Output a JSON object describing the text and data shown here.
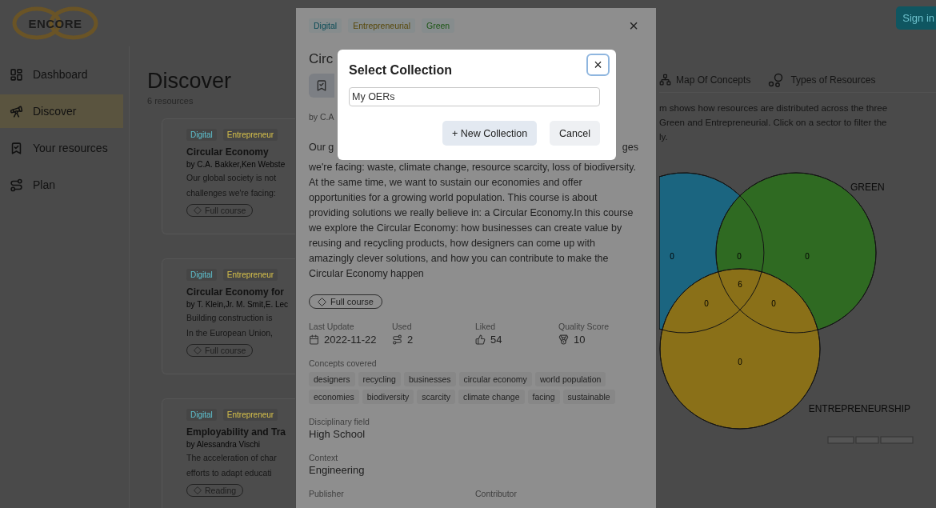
{
  "header": {
    "logo": "ENCORE",
    "sign_in": "Sign in"
  },
  "sidebar": {
    "items": [
      {
        "label": "Dashboard",
        "selected": false
      },
      {
        "label": "Discover",
        "selected": true
      },
      {
        "label": "Your resources",
        "selected": false
      },
      {
        "label": "Plan",
        "selected": false
      }
    ]
  },
  "discover": {
    "title": "Discover",
    "count": "6 resources",
    "cards": [
      {
        "tags": [
          {
            "label": "Digital",
            "color": "#5ec3d1"
          },
          {
            "label": "Entrepreneur",
            "color": "#d6c04a"
          }
        ],
        "title": "Circular Economy",
        "authors": "by C.A. Bakker,Ken Webste",
        "summary_lines": [
          "Our global society is not",
          "challenges we're facing:"
        ],
        "type": "Full course"
      },
      {
        "tags": [
          {
            "label": "Digital",
            "color": "#5ec3d1"
          },
          {
            "label": "Entrepreneur",
            "color": "#d6c04a"
          }
        ],
        "title": "Circular Economy for",
        "authors": "by T. Klein,Jr. M. Smit,E. Lec",
        "summary_lines": [
          "Building construction is",
          "In the European Union,"
        ],
        "type": "Full course"
      },
      {
        "tags": [
          {
            "label": "Digital",
            "color": "#5ec3d1"
          },
          {
            "label": "Entrepreneur",
            "color": "#d6c04a"
          }
        ],
        "title": "Employability and Tra",
        "authors": "by Alessandra Vischi",
        "summary_lines": [
          "The acceleration of char",
          "efforts to adapt educati"
        ],
        "type": "Reading"
      }
    ]
  },
  "right_panel": {
    "tabs": [
      {
        "label": "Map Of Concepts"
      },
      {
        "label": "Types of Resources"
      }
    ],
    "description_lines": [
      "m shows how resources are distributed across the three",
      "Green and Entrepreneurial. Click on a sector to filter the",
      "ly."
    ],
    "venn": {
      "circles": [
        {
          "color": "#1b6580"
        },
        {
          "label": "GREEN",
          "color": "#2f6a22"
        },
        {
          "label": "ENTREPRENEURSHIP",
          "color": "#8a7018"
        }
      ],
      "regions": [
        "0",
        "0",
        "0",
        "6",
        "0",
        "0",
        "0"
      ]
    }
  },
  "drawer": {
    "tags": [
      {
        "label": "Digital",
        "color": "#0b4b56"
      },
      {
        "label": "Entrepreneurial",
        "color": "#574708"
      },
      {
        "label": "Green",
        "color": "#1c5514"
      }
    ],
    "close": "×",
    "title_fragment": "Circ",
    "byline_fragment": "by C.A",
    "first_line_left": "Our g",
    "first_line_right": "ges",
    "description": "we're facing: waste, climate change, resource scarcity, loss of biodiversity. At the same time, we want to sustain our economies and offer opportunities for a growing world population. This course is about providing solutions we really believe in: a Circular Economy.In this course we explore the Circular Economy: how businesses can create value by reusing and recycling products, how designers can come up with amazingly clever solutions, and how you can contribute to make the Circular Economy happen",
    "type": "Full course",
    "stats": [
      {
        "label": "Last Update",
        "value": "2022-11-22"
      },
      {
        "label": "Used",
        "value": "2"
      },
      {
        "label": "Liked",
        "value": "54"
      },
      {
        "label": "Quality Score",
        "value": "10"
      }
    ],
    "concepts_label": "Concepts covered",
    "concepts": [
      "designers",
      "recycling",
      "businesses",
      "circular economy",
      "world population",
      "economies",
      "biodiversity",
      "scarcity",
      "climate change",
      "facing",
      "sustainable"
    ],
    "fields": [
      {
        "label": "Disciplinary field",
        "value": "High School"
      },
      {
        "label": "Context",
        "value": "Engineering"
      }
    ],
    "bottom_labels": [
      "Publisher",
      "Contributor"
    ]
  },
  "dialog": {
    "title": "Select Collection",
    "close": "×",
    "value": "My OERs",
    "buttons": [
      {
        "label": "+ New Collection",
        "kind": "primary"
      },
      {
        "label": "Cancel",
        "kind": "secondary"
      }
    ]
  }
}
